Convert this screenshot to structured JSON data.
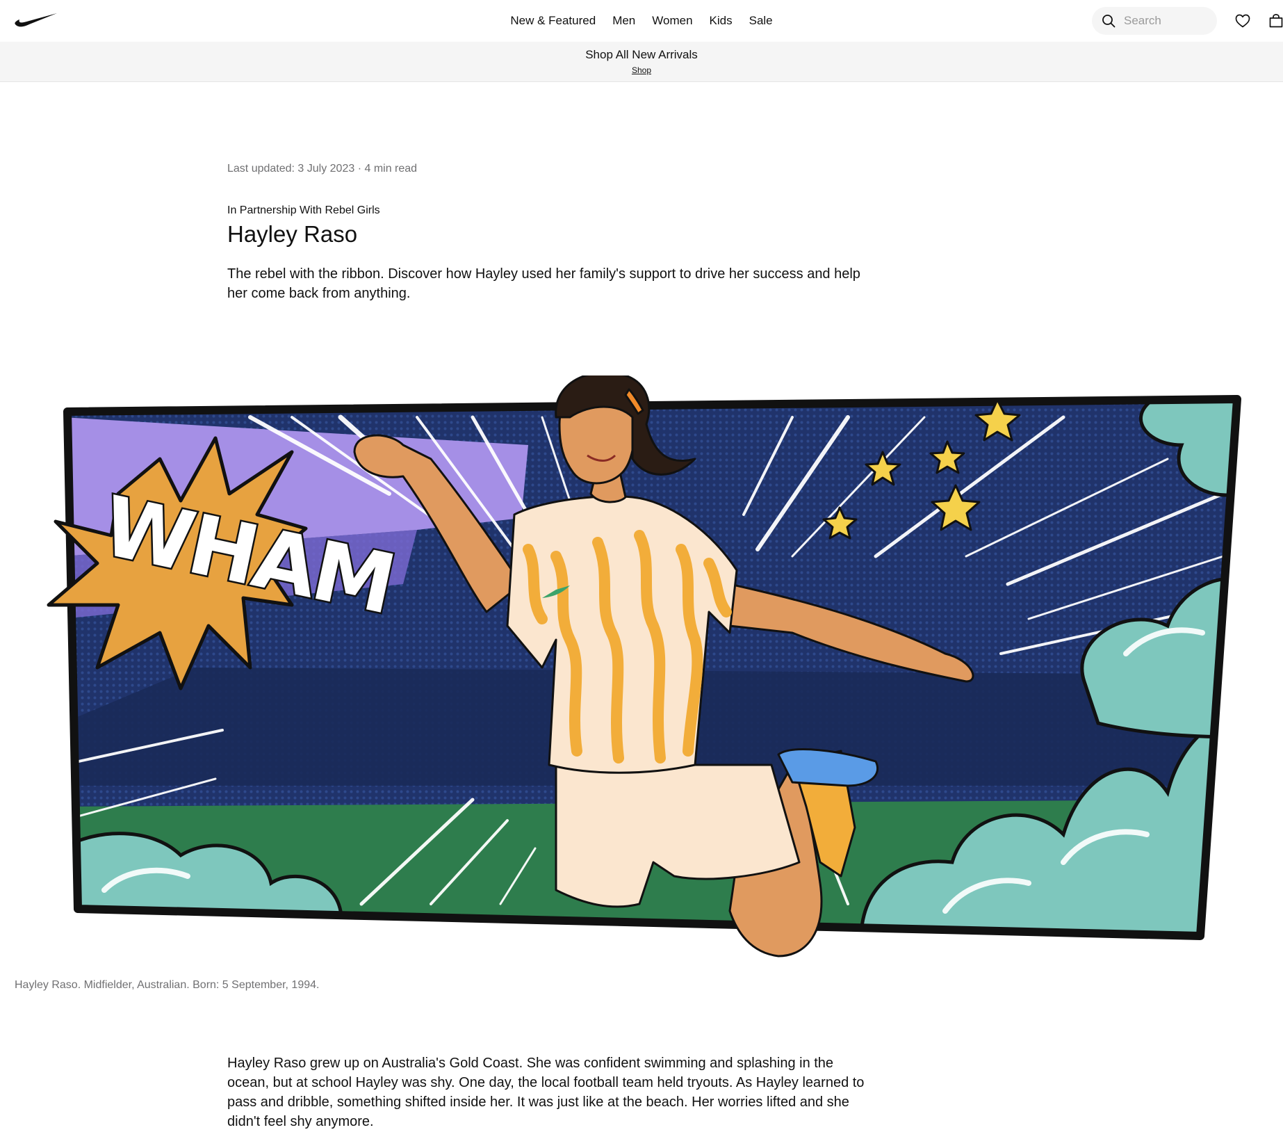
{
  "header": {
    "nav": [
      "New & Featured",
      "Men",
      "Women",
      "Kids",
      "Sale"
    ],
    "search_placeholder": "Search"
  },
  "promo": {
    "title": "Shop All New Arrivals",
    "link": "Shop"
  },
  "article": {
    "meta": "Last updated: 3 July 2023 · 4 min read",
    "eyebrow": "In Partnership With Rebel Girls",
    "title": "Hayley Raso",
    "dek": "The rebel with the ribbon. Discover how Hayley used her family's support to drive her success and help her come back from anything.",
    "caption": "Hayley Raso. Midfielder, Australian. Born: 5 September, 1994.",
    "body": "Hayley Raso grew up on Australia's Gold Coast. She was confident swimming and splashing in the ocean, but at school Hayley was shy. One day, the local football team held tryouts. As Hayley learned to pass and dribble, something shifted inside her. It was just like at the beach. Her worries lifted and she didn't feel shy anymore."
  },
  "illustration": {
    "wordmark": "WHAM"
  },
  "colors": {
    "panel_navy": "#20336b",
    "purple": "#a58fe6",
    "pitch_green": "#2e7d4d",
    "cloud_teal": "#7ec7bd",
    "burst_orange": "#e7a240",
    "jersey_yellow": "#f2ad3a",
    "shorts_cream": "#fbe6cf",
    "boot_blue": "#5a9be6",
    "star_yellow": "#f5d14b"
  }
}
